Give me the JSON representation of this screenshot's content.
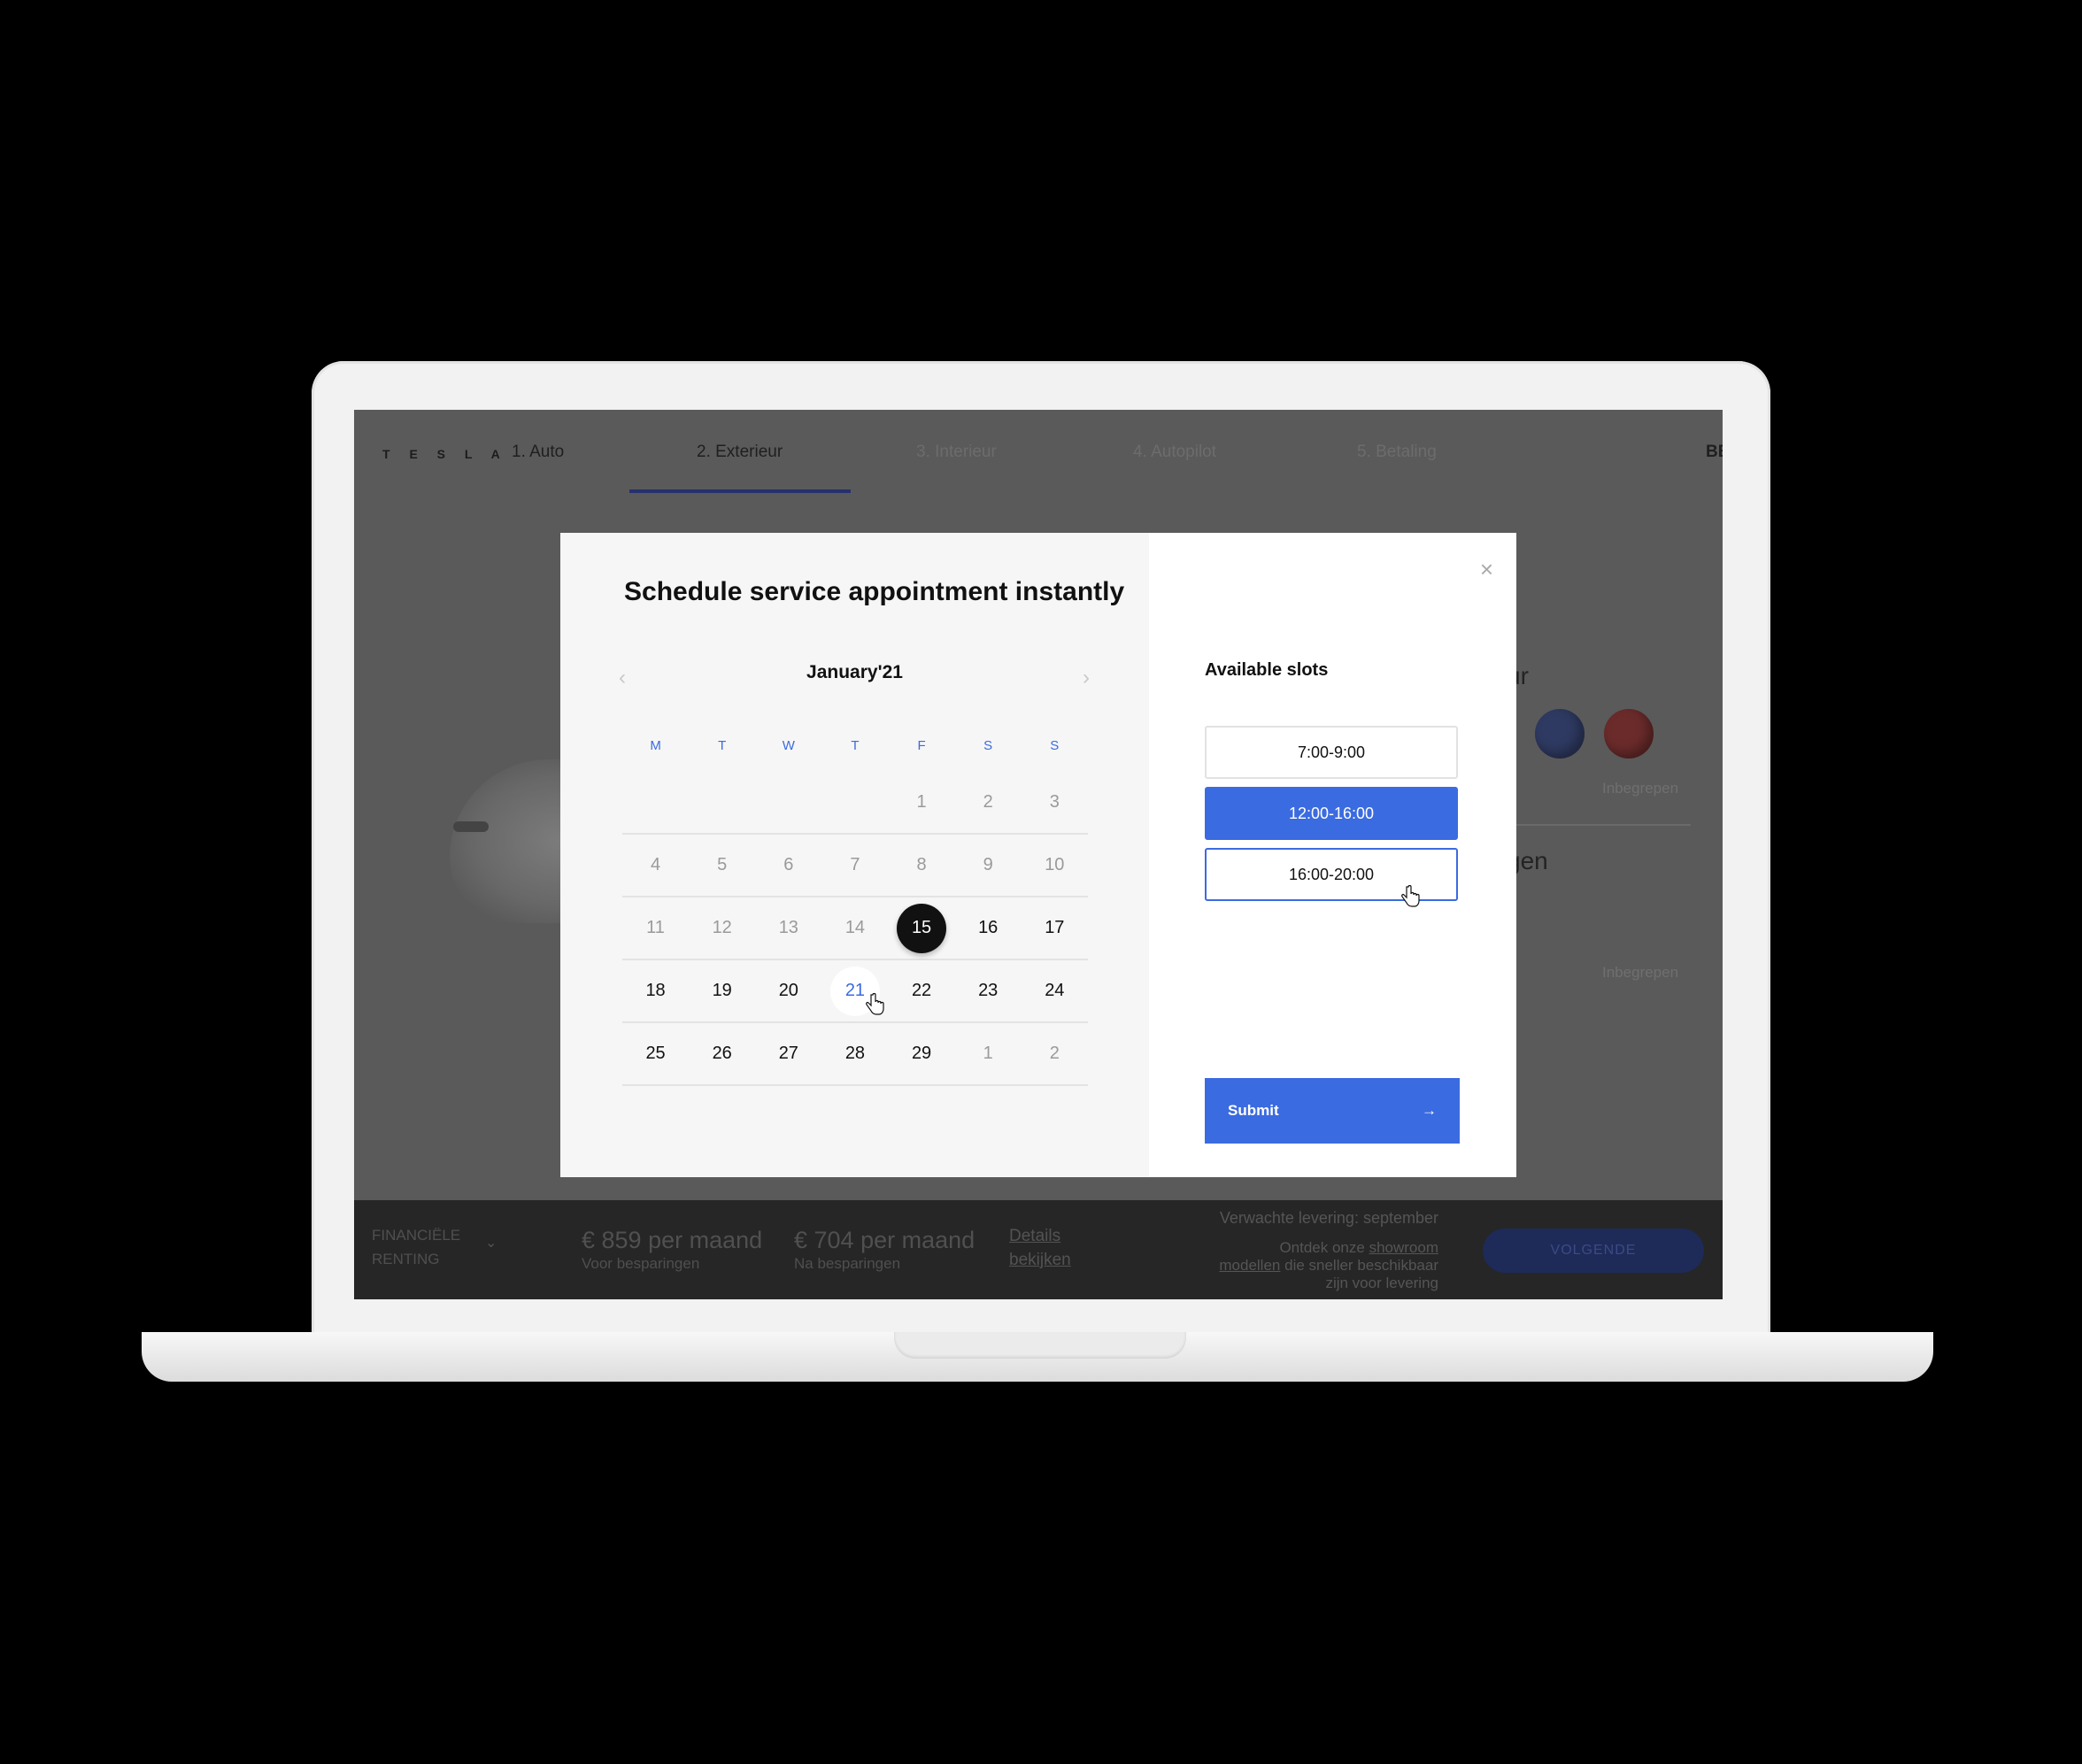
{
  "nav": {
    "logo": "T E S L A",
    "steps": [
      "1. Auto",
      "2. Exterieur",
      "3. Interieur",
      "4. Autopilot",
      "5. Betaling"
    ],
    "active_step": 1,
    "language": "BE"
  },
  "background": {
    "heading_color_partial": "ur",
    "heading_wheels_partial": "gen",
    "included_label": "Inbegrepen",
    "swatches": [
      "#3a4466",
      "#6b2e2e"
    ]
  },
  "bottom_bar": {
    "financing_line1": "FINANCIËLE",
    "financing_line2": "RENTING",
    "price_before": "€ 859 per maand",
    "price_before_label": "Voor besparingen",
    "price_after": "€ 704 per maand",
    "price_after_label": "Na besparingen",
    "details_line1": "Details",
    "details_line2": "bekijken",
    "delivery": "Verwachte levering: september",
    "showroom_pre": "Ontdek onze",
    "showroom_link1": "showroom",
    "showroom_link2": "modellen",
    "showroom_post": "die sneller beschikbaar",
    "showroom_post2": "zijn voor levering",
    "next_button": "VOLGENDE"
  },
  "modal": {
    "title": "Schedule service appointment instantly",
    "calendar": {
      "month_label": "January'21",
      "prev_icon": "chevron-left-icon",
      "next_icon": "chevron-right-icon",
      "weekdays": [
        "M",
        "T",
        "W",
        "T",
        "F",
        "S",
        "S"
      ],
      "weeks": [
        [
          {
            "d": ""
          },
          {
            "d": ""
          },
          {
            "d": ""
          },
          {
            "d": ""
          },
          {
            "d": "1",
            "s": "past"
          },
          {
            "d": "2",
            "s": "past"
          },
          {
            "d": "3",
            "s": "past"
          }
        ],
        [
          {
            "d": "4",
            "s": "past"
          },
          {
            "d": "5",
            "s": "past"
          },
          {
            "d": "6",
            "s": "past"
          },
          {
            "d": "7",
            "s": "past"
          },
          {
            "d": "8",
            "s": "past"
          },
          {
            "d": "9",
            "s": "past"
          },
          {
            "d": "10",
            "s": "past"
          }
        ],
        [
          {
            "d": "11",
            "s": "past"
          },
          {
            "d": "12",
            "s": "past"
          },
          {
            "d": "13",
            "s": "past"
          },
          {
            "d": "14",
            "s": "past"
          },
          {
            "d": "15",
            "s": "selected"
          },
          {
            "d": "16",
            "s": "avail"
          },
          {
            "d": "17",
            "s": "avail"
          }
        ],
        [
          {
            "d": "18",
            "s": "avail"
          },
          {
            "d": "19",
            "s": "avail"
          },
          {
            "d": "20",
            "s": "avail"
          },
          {
            "d": "21",
            "s": "hover"
          },
          {
            "d": "22",
            "s": "avail"
          },
          {
            "d": "23",
            "s": "avail"
          },
          {
            "d": "24",
            "s": "avail"
          }
        ],
        [
          {
            "d": "25",
            "s": "avail"
          },
          {
            "d": "26",
            "s": "avail"
          },
          {
            "d": "27",
            "s": "avail"
          },
          {
            "d": "28",
            "s": "avail"
          },
          {
            "d": "29",
            "s": "avail"
          },
          {
            "d": "1",
            "s": "past"
          },
          {
            "d": "2",
            "s": "past"
          }
        ]
      ]
    },
    "slots_title": "Available slots",
    "slots": [
      {
        "label": "7:00-9:00",
        "state": "default"
      },
      {
        "label": "12:00-16:00",
        "state": "selected"
      },
      {
        "label": "16:00-20:00",
        "state": "hover"
      }
    ],
    "submit_label": "Submit",
    "submit_icon": "arrow-right-icon",
    "close_icon": "close-icon",
    "accent_color": "#3b6be0"
  }
}
